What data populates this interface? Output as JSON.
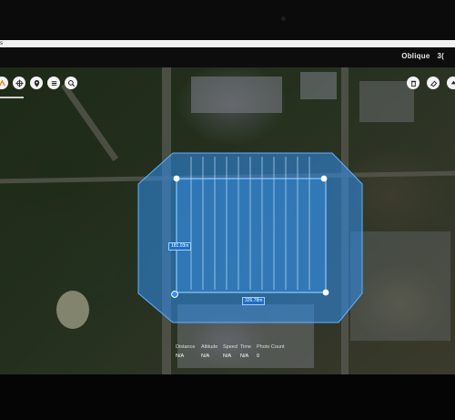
{
  "header": {
    "strip_text": "s",
    "view_modes": [
      "Oblique",
      "3("
    ]
  },
  "left_toolbar": {
    "buttons": [
      {
        "icon": "route-icon"
      },
      {
        "icon": "crosshair-icon"
      },
      {
        "icon": "location-pin-icon"
      },
      {
        "icon": "list-icon"
      },
      {
        "icon": "search-icon"
      }
    ]
  },
  "right_toolbar": {
    "buttons": [
      {
        "icon": "trash-icon"
      },
      {
        "icon": "eraser-icon"
      },
      {
        "icon": "up-arrow-icon"
      }
    ]
  },
  "survey": {
    "fill_color": "#2f8ff0",
    "outline_color": "#5fb3ff",
    "edge_labels": {
      "left": "181.03m",
      "bottom": "326.78m"
    }
  },
  "stats": {
    "distance": {
      "label": "Distance",
      "value": "N/A"
    },
    "altitude": {
      "label": "Altitude",
      "value": "N/A"
    },
    "speed": {
      "label": "Speed",
      "value": "N/A"
    },
    "time": {
      "label": "Time",
      "value": "N/A"
    },
    "photo_count": {
      "label": "Photo Count",
      "value": "0"
    }
  }
}
